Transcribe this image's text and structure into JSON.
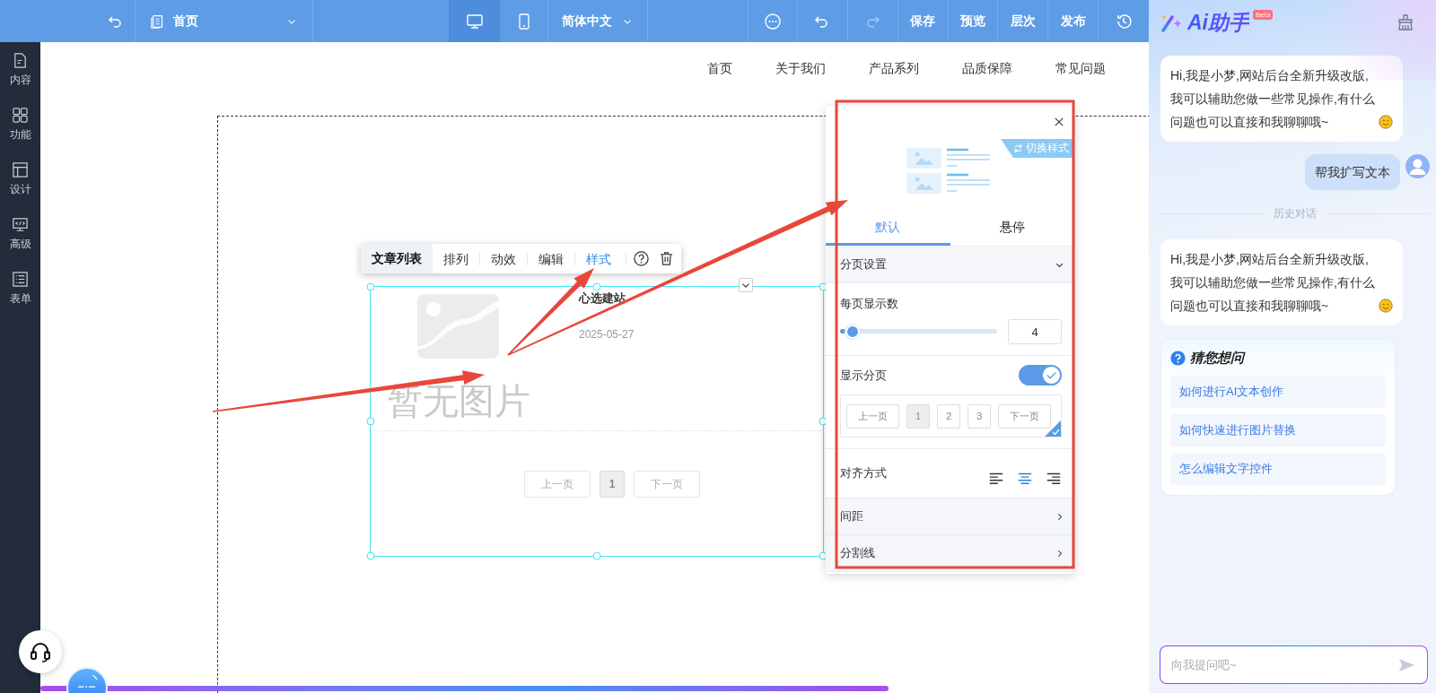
{
  "topbar": {
    "page_select": "首页",
    "view_modes": [
      {
        "kind": "desktop",
        "selected": true
      },
      {
        "kind": "mobile",
        "selected": false
      }
    ],
    "language": "简体中文",
    "redo_disabled": true,
    "actions": [
      "保存",
      "预览",
      "层次",
      "发布"
    ]
  },
  "sidebar": {
    "items": [
      {
        "kind": "content",
        "label": "内容"
      },
      {
        "kind": "function",
        "label": "功能"
      },
      {
        "kind": "design",
        "label": "设计"
      },
      {
        "kind": "advanced",
        "label": "高级"
      },
      {
        "kind": "form",
        "label": "表单"
      }
    ]
  },
  "site": {
    "nav": [
      "首页",
      "关于我们",
      "产品系列",
      "品质保障",
      "常见问题"
    ],
    "toolbar": {
      "title": "文章列表",
      "items": [
        {
          "label": "排列",
          "selected": false
        },
        {
          "label": "动效",
          "selected": false
        },
        {
          "label": "编辑",
          "selected": false
        },
        {
          "label": "样式",
          "selected": true
        }
      ]
    },
    "article": {
      "image_text": "暂无图片",
      "title": "心选建站",
      "date": "2025-05-27"
    },
    "pagination": [
      {
        "label": "上一页",
        "selected": false
      },
      {
        "label": "1",
        "selected": true
      },
      {
        "label": "下一页",
        "selected": false
      }
    ]
  },
  "style_panel": {
    "switch_label": "切换样式",
    "tabs": [
      {
        "label": "默认",
        "selected": true
      },
      {
        "label": "悬停",
        "selected": false
      }
    ],
    "page_settings": {
      "label": "分页设置",
      "expanded": true,
      "per_page": {
        "label": "每页显示数",
        "level": 0.08,
        "value": "4"
      },
      "show_pagination": {
        "label": "显示分页",
        "on": true
      },
      "preview": {
        "selected": true,
        "buttons": [
          {
            "label": "上一页",
            "selected": false
          },
          {
            "label": "1",
            "selected": true
          },
          {
            "label": "2",
            "selected": false
          },
          {
            "label": "3",
            "selected": false
          },
          {
            "label": "下一页",
            "selected": false
          }
        ]
      },
      "alignment": {
        "label": "对齐方式",
        "options": [
          {
            "kind": "left",
            "selected": false
          },
          {
            "kind": "center",
            "selected": true
          },
          {
            "kind": "right",
            "selected": false
          }
        ]
      }
    },
    "sections": [
      {
        "label": "间距",
        "expanded": false
      },
      {
        "label": "分割线",
        "expanded": false
      }
    ]
  },
  "ai_panel": {
    "title": "Ai助手",
    "badge": "Beta",
    "messages": [
      {
        "kind": "bot",
        "text": "Hi,我是小梦,网站后台全新升级改版,我可以辅助您做一些常见操作,有什么问题也可以直接和我聊聊哦~"
      },
      {
        "kind": "user",
        "text": "帮我扩写文本"
      },
      {
        "kind": "divider",
        "text": "历史对话"
      },
      {
        "kind": "bot",
        "text": "Hi,我是小梦,网站后台全新升级改版,我可以辅助您做一些常见操作,有什么问题也可以直接和我聊聊哦~"
      }
    ],
    "suggestions": {
      "title": "猜您想问",
      "items": [
        "如何进行AI文本创作",
        "如何快速进行图片替换",
        "怎么编辑文字控件"
      ]
    },
    "input": {
      "placeholder": "向我提问吧~"
    }
  }
}
